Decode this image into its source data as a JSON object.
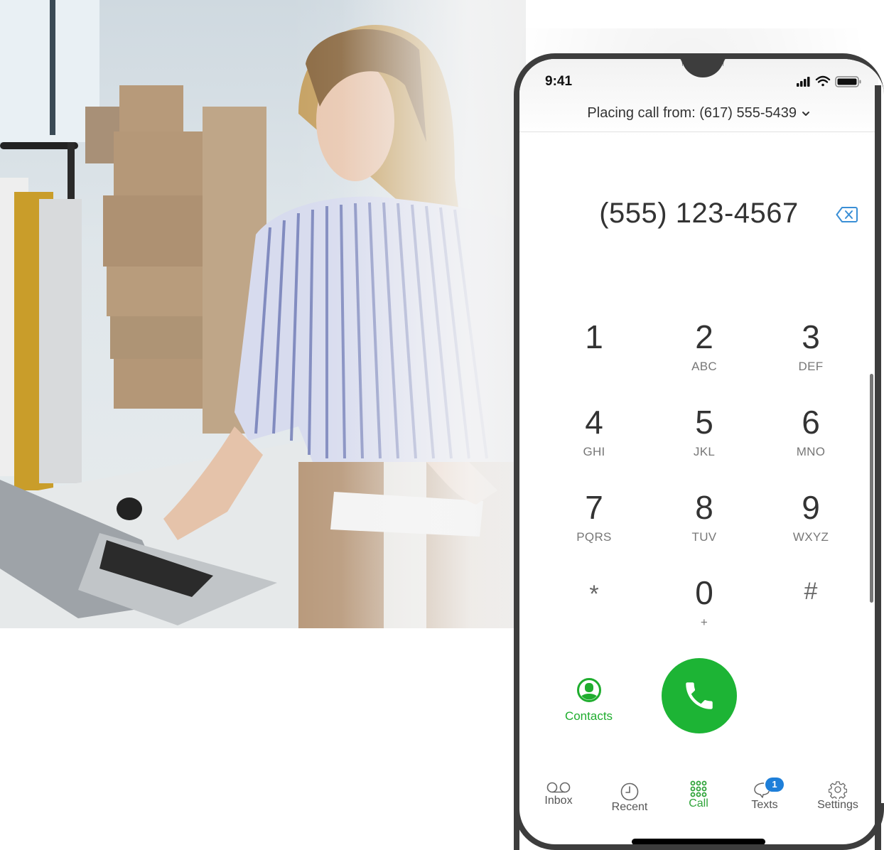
{
  "photo": {
    "description": "Woman in striped shirt typing on laptop beside stacked cardboard shipping boxes",
    "colors": {
      "wall": "#dfe6ea",
      "box": "#b79a7a",
      "shirt_stripe": "#6c78b4",
      "hair": "#c9a46a",
      "laptop": "#a9adb2"
    }
  },
  "status_bar": {
    "time": "9:41",
    "icons": [
      "signal-icon",
      "wifi-icon",
      "battery-icon"
    ]
  },
  "header": {
    "caller_id_label": "Placing call from: (617) 555-5439"
  },
  "dialer": {
    "number": "(555) 123-4567"
  },
  "keypad": [
    {
      "digit": "1",
      "letters": ""
    },
    {
      "digit": "2",
      "letters": "ABC"
    },
    {
      "digit": "3",
      "letters": "DEF"
    },
    {
      "digit": "4",
      "letters": "GHI"
    },
    {
      "digit": "5",
      "letters": "JKL"
    },
    {
      "digit": "6",
      "letters": "MNO"
    },
    {
      "digit": "7",
      "letters": "PQRS"
    },
    {
      "digit": "8",
      "letters": "TUV"
    },
    {
      "digit": "9",
      "letters": "WXYZ"
    },
    {
      "digit": "*",
      "letters": ""
    },
    {
      "digit": "0",
      "letters": "+"
    },
    {
      "digit": "#",
      "letters": ""
    }
  ],
  "actions": {
    "contacts_label": "Contacts"
  },
  "tabs": [
    {
      "label": "Inbox",
      "icon": "voicemail-icon",
      "active": false
    },
    {
      "label": "Recent",
      "icon": "clock-icon",
      "active": false
    },
    {
      "label": "Call",
      "icon": "keypad-icon",
      "active": true
    },
    {
      "label": "Texts",
      "icon": "chat-bubble-icon",
      "active": false,
      "badge": "1"
    },
    {
      "label": "Settings",
      "icon": "gear-icon",
      "active": false
    }
  ],
  "colors": {
    "accent_green": "#1db435",
    "badge_blue": "#1e7fd9",
    "frame": "#3d3d3d",
    "backspace_blue": "#3a8fd6"
  }
}
